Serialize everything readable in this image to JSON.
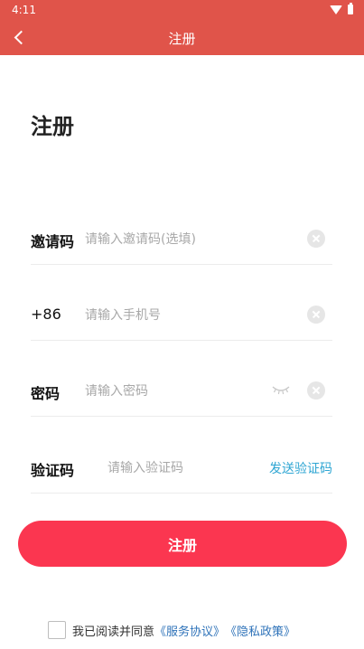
{
  "status_bar": {
    "time": "4:11",
    "icons": [
      "wifi-icon",
      "battery-icon"
    ]
  },
  "nav": {
    "title": "注册",
    "back_icon": "chevron-left-icon"
  },
  "page": {
    "title": "注册"
  },
  "form": {
    "invite": {
      "label": "邀请码",
      "value": "",
      "placeholder": "请输入邀请码(选填)"
    },
    "phone": {
      "label": "+86",
      "value": "",
      "placeholder": "请输入手机号"
    },
    "password": {
      "label": "密码",
      "value": "",
      "placeholder": "请输入密码",
      "visibility_icon": "eye-closed-icon"
    },
    "code": {
      "label": "验证码",
      "value": "",
      "placeholder": "请输入验证码",
      "send_label": "发送验证码"
    }
  },
  "submit": {
    "label": "注册"
  },
  "agreement": {
    "checked": false,
    "text": "我已阅读并同意",
    "service_link": "《服务协议》",
    "privacy_link": "《隐私政策》"
  },
  "colors": {
    "header": "#e0544a",
    "primary": "#fb3650",
    "send_link": "#2fa6d3",
    "agreement_link": "#2f73b9"
  }
}
